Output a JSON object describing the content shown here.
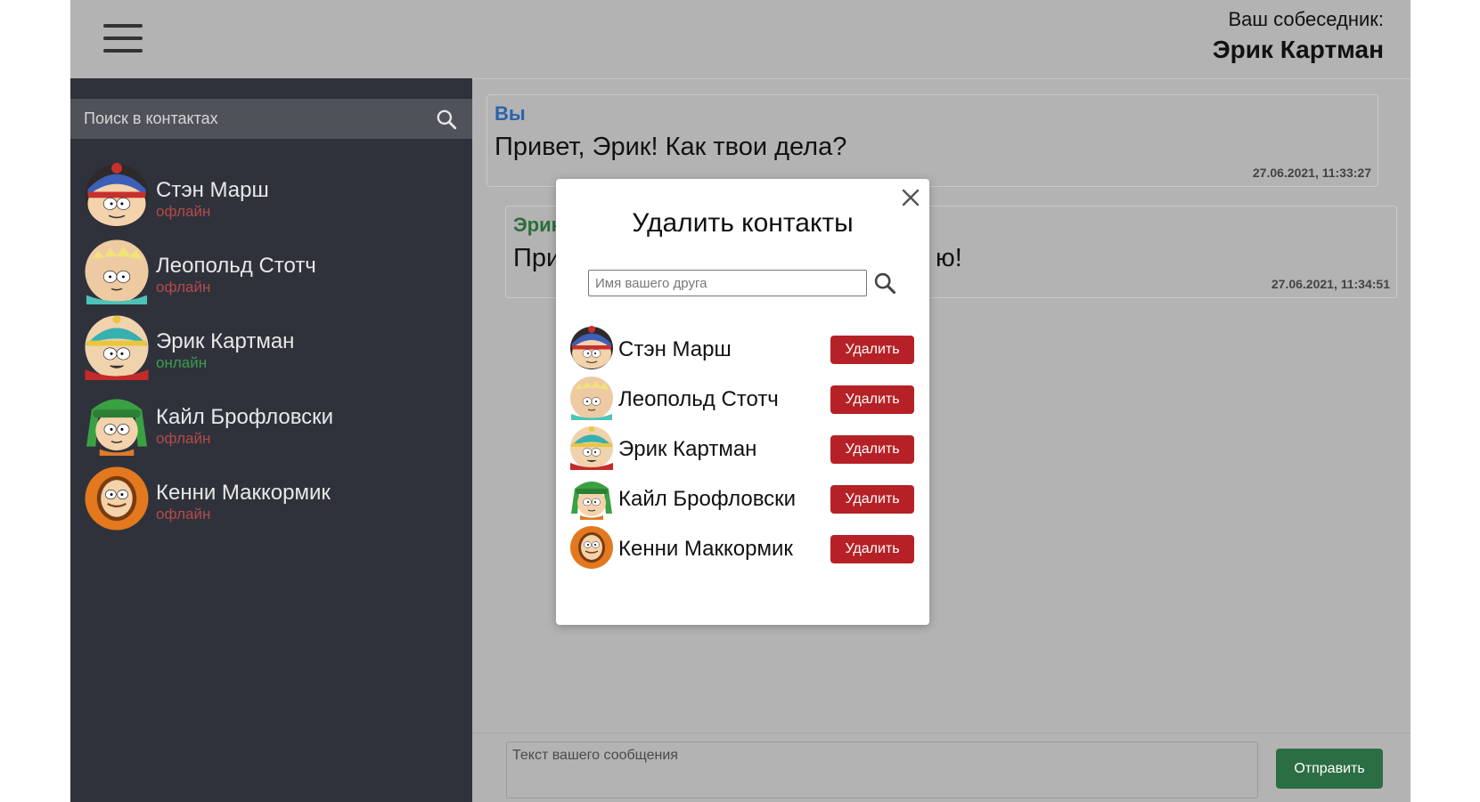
{
  "colors": {
    "sidebar_bg": "#2f323b",
    "content_bg": "#b3b3b3",
    "offline": "#b44a4a",
    "online": "#3c9a50",
    "you_author": "#2a63ad",
    "friend_author": "#2c6e3a",
    "delete_button": "#b52126",
    "send_button": "#2c6e44"
  },
  "header": {
    "menu_icon": "hamburger-menu-icon",
    "interlocutor_caption": "Ваш собеседник:",
    "interlocutor_name": "Эрик Картман"
  },
  "sidebar": {
    "search_placeholder": "Поиск в контактах",
    "search_icon": "search-icon",
    "contacts": [
      {
        "name": "Стэн Марш",
        "status": "офлайн",
        "online": false,
        "avatar": "stan-avatar"
      },
      {
        "name": "Леопольд Стотч",
        "status": "офлайн",
        "online": false,
        "avatar": "butters-avatar"
      },
      {
        "name": "Эрик Картман",
        "status": "онлайн",
        "online": true,
        "avatar": "cartman-avatar"
      },
      {
        "name": "Кайл Брофловски",
        "status": "офлайн",
        "online": false,
        "avatar": "kyle-avatar"
      },
      {
        "name": "Кенни Маккормик",
        "status": "офлайн",
        "online": false,
        "avatar": "kenny-avatar"
      }
    ]
  },
  "messages": [
    {
      "author": "Вы",
      "text": "Привет, Эрик! Как твои дела?",
      "time": "27.06.2021, 11:33:27"
    },
    {
      "author": "Эрик",
      "text_visible_left": "При",
      "text_visible_right": "ю!",
      "time": "27.06.2021, 11:34:51"
    }
  ],
  "compose": {
    "placeholder": "Текст вашего сообщения",
    "send_label": "Отправить"
  },
  "modal": {
    "title": "Удалить контакты",
    "search_placeholder": "Имя вашего друга",
    "close_icon": "close-icon",
    "delete_label": "Удалить",
    "contacts": [
      {
        "name": "Стэн Марш",
        "avatar": "stan-avatar"
      },
      {
        "name": "Леопольд Стотч",
        "avatar": "butters-avatar"
      },
      {
        "name": "Эрик Картман",
        "avatar": "cartman-avatar"
      },
      {
        "name": "Кайл Брофловски",
        "avatar": "kyle-avatar"
      },
      {
        "name": "Кенни Маккормик",
        "avatar": "kenny-avatar"
      }
    ]
  }
}
